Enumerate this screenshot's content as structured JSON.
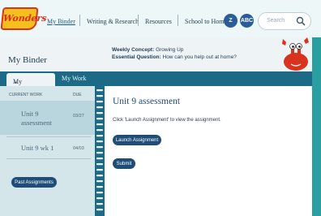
{
  "header": {
    "logo_text": "Wonders",
    "nav": {
      "my_binder": "My Binder",
      "writing_research": "Writing & Research",
      "resources": "Resources",
      "school_to_home": "School to Home"
    },
    "icon_buttons": {
      "z_label": "Z",
      "abc_label": "ABC"
    },
    "search": {
      "placeholder": "Search"
    }
  },
  "binder": {
    "title": "My Binder",
    "concept_label": "Weekly Concept:",
    "concept_value": "Growing Up",
    "question_label": "Essential Question:",
    "question_value": "How can you help out at home?"
  },
  "tabs": {
    "todo": "My To Do List",
    "work": "My Work"
  },
  "todo": {
    "col_current": "CURRENT WORK",
    "col_due": "DUE",
    "items": [
      {
        "line1": "Unit 9",
        "line2": "assessment",
        "due": "03/27"
      },
      {
        "line1": "Unit 9 wk 1",
        "line2": "",
        "due": "04/03"
      }
    ],
    "past_button": "Past Assignments"
  },
  "main": {
    "title": "Unit 9 assessment",
    "description": "Click 'Launch Assignment' to view the assignment.",
    "launch_button": "Launch Assignment",
    "submit_button": "Submit"
  },
  "colors": {
    "background_teal": "#2a9fa2",
    "tab_bar": "#1c6a86",
    "button_navy": "#1f4d77",
    "logo_yellow": "#f4c01e",
    "logo_red": "#d9321f"
  }
}
